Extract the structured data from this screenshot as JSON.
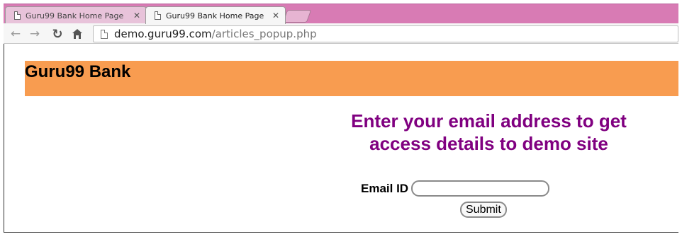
{
  "tabs": [
    {
      "title": "Guru99 Bank Home Page",
      "close": "✕"
    },
    {
      "title": "Guru99 Bank Home Page",
      "close": "✕"
    }
  ],
  "toolbar": {
    "back_icon": "arrow-left-icon",
    "forward_icon": "arrow-right-icon",
    "reload_icon": "reload-icon",
    "home_icon": "home-icon",
    "url_host": "demo.guru99.com",
    "url_path": "/articles_popup.php"
  },
  "page": {
    "brand": "Guru99 Bank",
    "headline": "Enter your email address to get access details to demo site",
    "email_label": "Email ID",
    "email_value": "",
    "submit_label": "Submit"
  },
  "colors": {
    "tab_strip": "#d87bb4",
    "banner": "#f89c50",
    "headline": "#800080"
  }
}
